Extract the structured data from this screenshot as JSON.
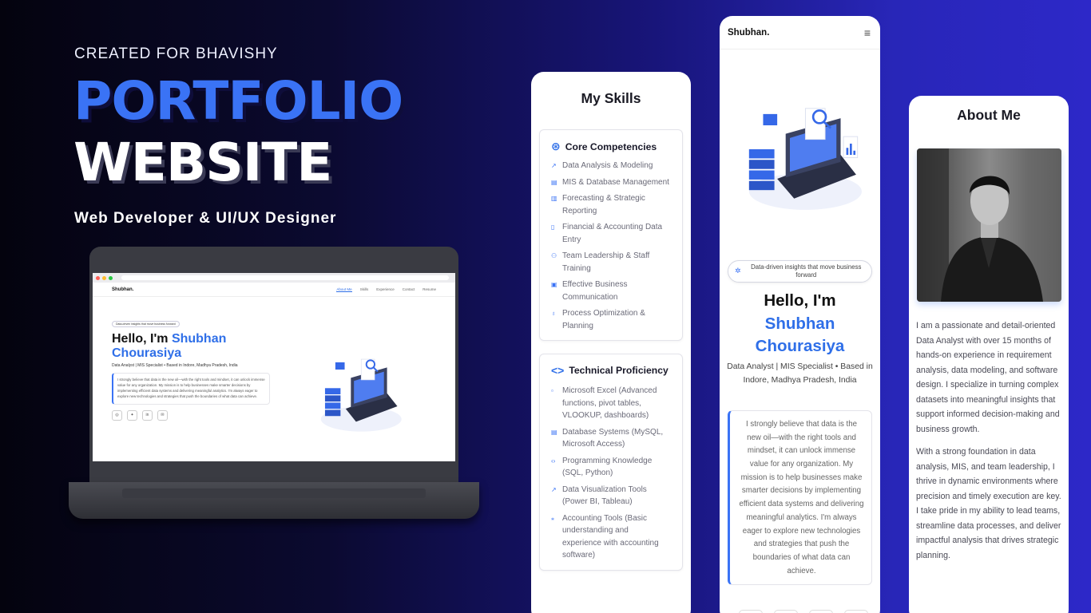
{
  "hero": {
    "eyebrow": "CREATED FOR BHAVISHY",
    "title_line1": "PORTFOLIO",
    "title_line2": "WEBSITE",
    "tagline": "Web Developer & UI/UX Designer"
  },
  "laptop_site": {
    "brand": "Shubhan.",
    "nav": [
      "About Me",
      "Skills",
      "Experience",
      "Contact",
      "Resume"
    ],
    "pill": "Data-driven insights that move business forward",
    "hello_prefix": "Hello, I'm ",
    "hello_name1": "Shubhan",
    "hello_name2": "Chourasiya",
    "subtitle": "Data Analyst | MIS Specialist • Based in Indore, Madhya Pradesh, India",
    "quote": "I strongly believe that data is the new oil—with the right tools and mindset, it can unlock immense value for any organization. My mission is to help businesses make smarter decisions by implementing efficient data systems and delivering meaningful analytics. I'm always eager to explore new technologies and strategies that push the boundaries of what data can achieve."
  },
  "skills_screen": {
    "title": "My Skills",
    "core": {
      "heading": "Core Competencies",
      "items": [
        "Data Analysis & Modeling",
        "MIS & Database Management",
        "Forecasting & Strategic Reporting",
        "Financial & Accounting Data Entry",
        "Team Leadership & Staff Training",
        "Effective Business Communication",
        "Process Optimization & Planning"
      ]
    },
    "tech": {
      "heading": "Technical Proficiency",
      "items": [
        "Microsoft Excel (Advanced functions, pivot tables, VLOOKUP, dashboards)",
        "Database Systems (MySQL, Microsoft Access)",
        "Programming Knowledge (SQL, Python)",
        "Data Visualization Tools (Power BI, Tableau)",
        "Accounting Tools (Basic understanding and experience with accounting software)"
      ]
    }
  },
  "home_screen": {
    "brand": "Shubhan.",
    "menu_icon": "hamburger-icon",
    "pill": "Data-driven insights that move business forward",
    "hello": "Hello, I'm",
    "name_line1": "Shubhan",
    "name_line2": "Chourasiya",
    "subtitle": "Data Analyst | MIS Specialist • Based in Indore, Madhya Pradesh, India",
    "quote": "I strongly believe that data is the new oil—with the right tools and mindset, it can unlock immense value for any organization. My mission is to help businesses make smarter decisions by implementing efficient data systems and delivering meaningful analytics. I'm always eager to explore new technologies and strategies that push the boundaries of what data can achieve."
  },
  "about_screen": {
    "title": "About Me",
    "para1": "I am a passionate and detail-oriented Data Analyst with over 15 months of hands-on experience in requirement analysis, data modeling, and software design. I specialize in turning complex datasets into meaningful insights that support informed decision-making and business growth.",
    "para2": "With a strong foundation in data analysis, MIS, and team leadership, I thrive in dynamic environments where precision and timely execution are key. I take pride in my ability to lead teams, streamline data processes, and deliver impactful analysis that drives strategic planning."
  },
  "colors": {
    "accent": "#2f6fe8",
    "title_blue": "#3a73f5",
    "bg_dark": "#04030e",
    "bg_blue": "#2d28c8"
  }
}
